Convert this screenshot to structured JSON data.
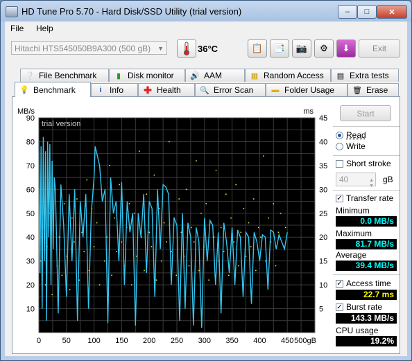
{
  "window": {
    "title": "HD Tune Pro 5.70 - Hard Disk/SSD Utility (trial version)",
    "buttons": {
      "minimize": "–",
      "maximize": "□",
      "close": "✕"
    }
  },
  "menu": {
    "file": "File",
    "help": "Help"
  },
  "toolbar": {
    "drive": "Hitachi HTS545050B9A300 (500 gB)",
    "temperature": "36°C",
    "exit": "Exit",
    "icons": [
      "copy-icon",
      "copy-info-icon",
      "screenshot-icon",
      "settings-icon",
      "save-icon"
    ]
  },
  "tabs": {
    "top": [
      "File Benchmark",
      "Disk monitor",
      "AAM",
      "Random Access",
      "Extra tests"
    ],
    "bottom": [
      "Benchmark",
      "Info",
      "Health",
      "Error Scan",
      "Folder Usage",
      "Erase"
    ],
    "active": "Benchmark"
  },
  "controls": {
    "start": "Start",
    "read": "Read",
    "write": "Write",
    "mode": "Read",
    "short_stroke": "Short stroke",
    "short_stroke_checked": false,
    "stroke_value": "40",
    "stroke_unit": "gB",
    "transfer_rate": "Transfer rate",
    "transfer_rate_checked": true,
    "minimum_label": "Minimum",
    "minimum": "0.0 MB/s",
    "maximum_label": "Maximum",
    "maximum": "81.7 MB/s",
    "average_label": "Average",
    "average": "39.4 MB/s",
    "access_time": "Access time",
    "access_time_checked": true,
    "access_time_value": "22.7 ms",
    "burst_rate": "Burst rate",
    "burst_rate_checked": true,
    "burst_rate_value": "143.3 MB/s",
    "cpu_usage_label": "CPU usage",
    "cpu_usage": "19.2%",
    "colors": {
      "minimum": "#00ffff",
      "maximum": "#00ffff",
      "average": "#00ffff",
      "access": "#ffff00",
      "burst": "#ffffff",
      "cpu": "#ffffff"
    }
  },
  "chart_data": {
    "type": "line",
    "watermark": "trial version",
    "y_left_label": "MB/s",
    "y_right_label": "ms",
    "ylim_left": [
      0,
      90
    ],
    "ylim_right": [
      0,
      45
    ],
    "xlim": [
      0,
      500
    ],
    "x_ticks": [
      "0",
      "50",
      "100",
      "150",
      "200",
      "250",
      "300",
      "350",
      "400",
      "450",
      "500gB"
    ],
    "y_left_ticks": [
      "10",
      "20",
      "30",
      "40",
      "50",
      "60",
      "70",
      "80",
      "90"
    ],
    "y_right_ticks": [
      "5",
      "10",
      "15",
      "20",
      "25",
      "30",
      "35",
      "40",
      "45"
    ],
    "grid": true,
    "series": [
      {
        "name": "Transfer rate",
        "color": "#33c6f0",
        "x": [
          0,
          2,
          4,
          6,
          8,
          10,
          12,
          14,
          16,
          18,
          20,
          22,
          24,
          26,
          28,
          30,
          35,
          40,
          45,
          50,
          55,
          60,
          65,
          70,
          75,
          80,
          85,
          90,
          95,
          100,
          102,
          105,
          110,
          115,
          120,
          125,
          130,
          135,
          140,
          145,
          150,
          155,
          160,
          165,
          170,
          175,
          180,
          185,
          190,
          195,
          200,
          205,
          210,
          215,
          220,
          225,
          230,
          235,
          240,
          245,
          250,
          255,
          260,
          265,
          270,
          275,
          280,
          285,
          290,
          295,
          300,
          305,
          310,
          315,
          320,
          325,
          330,
          335,
          340,
          345,
          350,
          355,
          360,
          365,
          370,
          375,
          380,
          385,
          390,
          395,
          400,
          405,
          410,
          415,
          420,
          425,
          430,
          435,
          440,
          445,
          450
        ],
        "y": [
          80,
          25,
          78,
          10,
          82,
          30,
          76,
          5,
          80,
          40,
          79,
          20,
          72,
          35,
          65,
          60,
          8,
          62,
          45,
          15,
          58,
          30,
          60,
          5,
          55,
          40,
          58,
          10,
          50,
          65,
          78,
          75,
          70,
          55,
          60,
          4,
          65,
          50,
          55,
          30,
          63,
          20,
          55,
          42,
          50,
          3,
          50,
          40,
          58,
          25,
          55,
          52,
          15,
          60,
          35,
          62,
          61,
          58,
          20,
          48,
          45,
          5,
          50,
          10,
          46,
          40,
          3,
          44,
          38,
          2,
          48,
          30,
          47,
          45,
          20,
          42,
          8,
          46,
          38,
          25,
          44,
          20,
          43,
          40,
          15,
          42,
          40,
          12,
          42,
          38,
          30,
          41,
          40,
          18,
          43,
          42,
          35,
          41,
          38,
          35,
          42
        ]
      },
      {
        "name": "Access time",
        "color": "#e8e83a",
        "axis": "right",
        "x": [
          3,
          7,
          12,
          15,
          19,
          24,
          28,
          33,
          37,
          42,
          46,
          51,
          56,
          60,
          64,
          69,
          73,
          78,
          82,
          87,
          91,
          96,
          100,
          105,
          110,
          114,
          119,
          123,
          128,
          132,
          137,
          141,
          146,
          150,
          155,
          159,
          164,
          168,
          173,
          177,
          182,
          186,
          191,
          195,
          200,
          204,
          209,
          213,
          218,
          222,
          227,
          231,
          236,
          240,
          245,
          249,
          254,
          258,
          263,
          267,
          272,
          276,
          281,
          285,
          290,
          294,
          299,
          303,
          308,
          312,
          317,
          321,
          326,
          330,
          335,
          339,
          344,
          348,
          353,
          357,
          362,
          366,
          371,
          375,
          380,
          384,
          389,
          393,
          398,
          402,
          407,
          411,
          416,
          420,
          425,
          429,
          434,
          438,
          443,
          447
        ],
        "y": [
          15,
          22,
          10,
          18,
          25,
          8,
          30,
          14,
          20,
          12,
          27,
          16,
          9,
          24,
          19,
          28,
          11,
          21,
          17,
          32,
          13,
          26,
          18,
          23,
          10,
          29,
          15,
          20,
          35,
          12,
          24,
          17,
          31,
          19,
          14,
          22,
          27,
          10,
          25,
          16,
          38,
          20,
          13,
          29,
          21,
          18,
          33,
          11,
          26,
          15,
          23,
          19,
          40,
          17,
          24,
          12,
          28,
          21,
          16,
          30,
          14,
          22,
          19,
          36,
          13,
          25,
          18,
          27,
          11,
          23,
          20,
          34,
          15,
          22,
          17,
          29,
          12,
          24,
          19,
          31,
          14,
          21,
          26,
          16,
          23,
          18,
          28,
          13,
          22,
          20,
          37,
          15,
          24,
          19,
          27,
          14,
          21,
          25,
          18,
          22
        ]
      }
    ]
  }
}
